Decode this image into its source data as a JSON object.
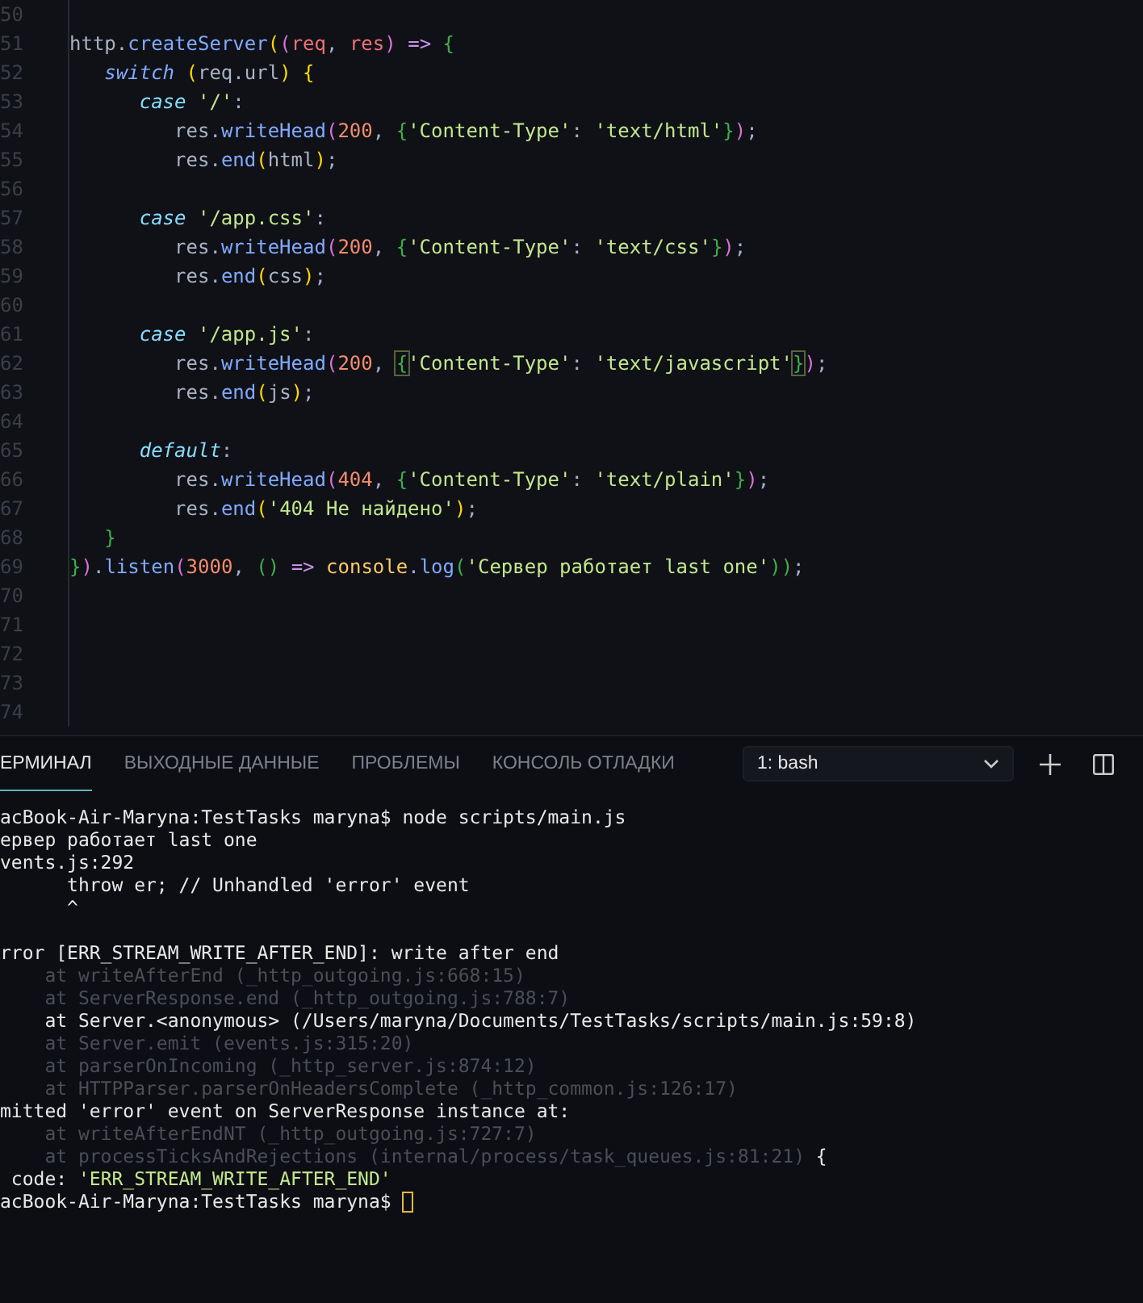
{
  "editor": {
    "lines": [
      {
        "number": "50"
      },
      {
        "number": "51",
        "tokens": [
          {
            "kind": "p",
            "text": "http"
          },
          {
            "kind": "o",
            "text": "."
          },
          {
            "kind": "f",
            "text": "createServer"
          },
          {
            "kind": "b1",
            "text": "("
          },
          {
            "kind": "b2",
            "text": "("
          },
          {
            "kind": "v",
            "text": "req"
          },
          {
            "kind": "o",
            "text": ", "
          },
          {
            "kind": "v",
            "text": "res"
          },
          {
            "kind": "b2",
            "text": ")"
          },
          {
            "kind": "op",
            "text": " => "
          },
          {
            "kind": "b3",
            "text": "{"
          }
        ]
      },
      {
        "number": "52",
        "tokens": [
          {
            "kind": "kw",
            "text": "   switch"
          },
          {
            "kind": "b1",
            "text": " ("
          },
          {
            "kind": "p",
            "text": "req"
          },
          {
            "kind": "o",
            "text": "."
          },
          {
            "kind": "p",
            "text": "url"
          },
          {
            "kind": "b1",
            "text": ")"
          },
          {
            "kind": "b1",
            "text": " {"
          }
        ]
      },
      {
        "number": "53",
        "tokens": [
          {
            "kind": "case",
            "text": "      case"
          },
          {
            "kind": "s",
            "text": " '/'"
          },
          {
            "kind": "o",
            "text": ":"
          }
        ]
      },
      {
        "number": "54",
        "tokens": [
          {
            "kind": "p",
            "text": "         res"
          },
          {
            "kind": "o",
            "text": "."
          },
          {
            "kind": "f",
            "text": "writeHead"
          },
          {
            "kind": "b2",
            "text": "("
          },
          {
            "kind": "n",
            "text": "200"
          },
          {
            "kind": "o",
            "text": ", "
          },
          {
            "kind": "b3",
            "text": "{"
          },
          {
            "kind": "s",
            "text": "'Content-Type'"
          },
          {
            "kind": "o",
            "text": ": "
          },
          {
            "kind": "s",
            "text": "'text/html'"
          },
          {
            "kind": "b3",
            "text": "}"
          },
          {
            "kind": "b2",
            "text": ")"
          },
          {
            "kind": "o",
            "text": ";"
          }
        ]
      },
      {
        "number": "55",
        "tokens": [
          {
            "kind": "p",
            "text": "         res"
          },
          {
            "kind": "o",
            "text": "."
          },
          {
            "kind": "f",
            "text": "end"
          },
          {
            "kind": "b1",
            "text": "("
          },
          {
            "kind": "p",
            "text": "html"
          },
          {
            "kind": "b1",
            "text": ")"
          },
          {
            "kind": "o",
            "text": ";"
          }
        ]
      },
      {
        "number": "56"
      },
      {
        "number": "57",
        "tokens": [
          {
            "kind": "case",
            "text": "      case"
          },
          {
            "kind": "s",
            "text": " '/app.css'"
          },
          {
            "kind": "o",
            "text": ":"
          }
        ]
      },
      {
        "number": "58",
        "tokens": [
          {
            "kind": "p",
            "text": "         res"
          },
          {
            "kind": "o",
            "text": "."
          },
          {
            "kind": "f",
            "text": "writeHead"
          },
          {
            "kind": "b2",
            "text": "("
          },
          {
            "kind": "n",
            "text": "200"
          },
          {
            "kind": "o",
            "text": ", "
          },
          {
            "kind": "b3",
            "text": "{"
          },
          {
            "kind": "s",
            "text": "'Content-Type'"
          },
          {
            "kind": "o",
            "text": ": "
          },
          {
            "kind": "s",
            "text": "'text/css'"
          },
          {
            "kind": "b3",
            "text": "}"
          },
          {
            "kind": "b2",
            "text": ")"
          },
          {
            "kind": "o",
            "text": ";"
          }
        ]
      },
      {
        "number": "59",
        "tokens": [
          {
            "kind": "p",
            "text": "         res"
          },
          {
            "kind": "o",
            "text": "."
          },
          {
            "kind": "f",
            "text": "end"
          },
          {
            "kind": "b1",
            "text": "("
          },
          {
            "kind": "p",
            "text": "css"
          },
          {
            "kind": "b1",
            "text": ")"
          },
          {
            "kind": "o",
            "text": ";"
          }
        ]
      },
      {
        "number": "60"
      },
      {
        "number": "61",
        "tokens": [
          {
            "kind": "case",
            "text": "      case"
          },
          {
            "kind": "s",
            "text": " '/app.js'"
          },
          {
            "kind": "o",
            "text": ":"
          }
        ]
      },
      {
        "number": "62",
        "tokens": [
          {
            "kind": "p",
            "text": "         res"
          },
          {
            "kind": "o",
            "text": "."
          },
          {
            "kind": "f",
            "text": "writeHead"
          },
          {
            "kind": "b2",
            "text": "("
          },
          {
            "kind": "n",
            "text": "200"
          },
          {
            "kind": "o",
            "text": ", "
          },
          {
            "kind": "match",
            "text": "{"
          },
          {
            "kind": "s",
            "text": "'Content-Type'"
          },
          {
            "kind": "o",
            "text": ": "
          },
          {
            "kind": "s",
            "text": "'text/javascript'"
          },
          {
            "kind": "match",
            "text": "}"
          },
          {
            "kind": "b2",
            "text": ")"
          },
          {
            "kind": "o",
            "text": ";"
          }
        ]
      },
      {
        "number": "63",
        "tokens": [
          {
            "kind": "p",
            "text": "         res"
          },
          {
            "kind": "o",
            "text": "."
          },
          {
            "kind": "f",
            "text": "end"
          },
          {
            "kind": "b1",
            "text": "("
          },
          {
            "kind": "p",
            "text": "js"
          },
          {
            "kind": "b1",
            "text": ")"
          },
          {
            "kind": "o",
            "text": ";"
          }
        ]
      },
      {
        "number": "64"
      },
      {
        "number": "65",
        "tokens": [
          {
            "kind": "case",
            "text": "      default"
          },
          {
            "kind": "o",
            "text": ":"
          }
        ]
      },
      {
        "number": "66",
        "tokens": [
          {
            "kind": "p",
            "text": "         res"
          },
          {
            "kind": "o",
            "text": "."
          },
          {
            "kind": "f",
            "text": "writeHead"
          },
          {
            "kind": "b2",
            "text": "("
          },
          {
            "kind": "n",
            "text": "404"
          },
          {
            "kind": "o",
            "text": ", "
          },
          {
            "kind": "b3",
            "text": "{"
          },
          {
            "kind": "s",
            "text": "'Content-Type'"
          },
          {
            "kind": "o",
            "text": ": "
          },
          {
            "kind": "s",
            "text": "'text/plain'"
          },
          {
            "kind": "b3",
            "text": "}"
          },
          {
            "kind": "b2",
            "text": ")"
          },
          {
            "kind": "o",
            "text": ";"
          }
        ]
      },
      {
        "number": "67",
        "tokens": [
          {
            "kind": "p",
            "text": "         res"
          },
          {
            "kind": "o",
            "text": "."
          },
          {
            "kind": "f",
            "text": "end"
          },
          {
            "kind": "b1",
            "text": "("
          },
          {
            "kind": "s",
            "text": "'404 Не найдено'"
          },
          {
            "kind": "b1",
            "text": ")"
          },
          {
            "kind": "o",
            "text": ";"
          }
        ]
      },
      {
        "number": "68",
        "tokens": [
          {
            "kind": "b3",
            "text": "   }"
          }
        ]
      },
      {
        "number": "69",
        "tokens": [
          {
            "kind": "b3",
            "text": "}"
          },
          {
            "kind": "b2",
            "text": ")"
          },
          {
            "kind": "o",
            "text": "."
          },
          {
            "kind": "f",
            "text": "listen"
          },
          {
            "kind": "b2",
            "text": "("
          },
          {
            "kind": "n",
            "text": "3000"
          },
          {
            "kind": "o",
            "text": ", "
          },
          {
            "kind": "b3",
            "text": "()"
          },
          {
            "kind": "op",
            "text": " => "
          },
          {
            "kind": "y",
            "text": "console"
          },
          {
            "kind": "o",
            "text": "."
          },
          {
            "kind": "f",
            "text": "log"
          },
          {
            "kind": "b3",
            "text": "("
          },
          {
            "kind": "s",
            "text": "'Сервер работает last one'"
          },
          {
            "kind": "b3",
            "text": "))"
          },
          {
            "kind": "o",
            "text": ";"
          }
        ]
      },
      {
        "number": "70"
      },
      {
        "number": "71"
      },
      {
        "number": "72"
      },
      {
        "number": "73"
      },
      {
        "number": "74"
      }
    ]
  },
  "panel": {
    "tabs": [
      {
        "label": "ЕРМИНАЛ",
        "selected": true
      },
      {
        "label": "ВЫХОДНЫЕ ДАННЫЕ",
        "selected": false
      },
      {
        "label": "ПРОБЛЕМЫ",
        "selected": false
      },
      {
        "label": "КОНСОЛЬ ОТЛАДКИ",
        "selected": false
      }
    ],
    "shell_select": "1: bash",
    "terminal": [
      {
        "kind": "normal",
        "parts": [
          {
            "kind": "t",
            "text": "acBook-Air-Maryna:TestTasks maryna$ node scripts/main.js"
          }
        ]
      },
      {
        "kind": "normal",
        "parts": [
          {
            "kind": "t",
            "text": "ервер работает last one"
          }
        ]
      },
      {
        "kind": "normal",
        "parts": [
          {
            "kind": "t",
            "text": "vents.js:292"
          }
        ]
      },
      {
        "kind": "normal",
        "parts": [
          {
            "kind": "t",
            "text": "      throw er; // Unhandled 'error' event"
          }
        ]
      },
      {
        "kind": "normal",
        "parts": [
          {
            "kind": "t",
            "text": "      ^"
          }
        ]
      },
      {
        "kind": "heading",
        "parts": [
          {
            "kind": "t",
            "text": "rror [ERR_STREAM_WRITE_AFTER_END]: write after end"
          }
        ]
      },
      {
        "kind": "dim",
        "parts": [
          {
            "kind": "t",
            "text": "    at writeAfterEnd (_http_outgoing.js:668:15)"
          }
        ]
      },
      {
        "kind": "dim",
        "parts": [
          {
            "kind": "t",
            "text": "    at ServerResponse.end (_http_outgoing.js:788:7)"
          }
        ]
      },
      {
        "kind": "normal",
        "parts": [
          {
            "kind": "t",
            "text": "    at Server.<anonymous> (/Users/maryna/Documents/TestTasks/scripts/main.js:59:8)"
          }
        ]
      },
      {
        "kind": "dim",
        "parts": [
          {
            "kind": "t",
            "text": "    at Server.emit (events.js:315:20)"
          }
        ]
      },
      {
        "kind": "dim",
        "parts": [
          {
            "kind": "t",
            "text": "    at parserOnIncoming (_http_server.js:874:12)"
          }
        ]
      },
      {
        "kind": "dim",
        "parts": [
          {
            "kind": "t",
            "text": "    at HTTPParser.parserOnHeadersComplete (_http_common.js:126:17)"
          }
        ]
      },
      {
        "kind": "normal",
        "parts": [
          {
            "kind": "t",
            "text": "mitted 'error' event on ServerResponse instance at:"
          }
        ]
      },
      {
        "kind": "dim",
        "parts": [
          {
            "kind": "t",
            "text": "    at writeAfterEndNT (_http_outgoing.js:727:7)"
          }
        ]
      },
      {
        "kind": "normal",
        "parts": [
          {
            "kind": "d",
            "text": "    at processTicksAndRejections (internal/process/task_queues.js:81:21)"
          },
          {
            "kind": "t",
            "text": " {"
          }
        ]
      },
      {
        "kind": "normal",
        "parts": [
          {
            "kind": "t",
            "text": " code: "
          },
          {
            "kind": "s",
            "text": "'ERR_STREAM_WRITE_AFTER_END'"
          }
        ]
      },
      {
        "kind": "prompt",
        "parts": [
          {
            "kind": "t",
            "text": "acBook-Air-Maryna:TestTasks maryna$"
          }
        ]
      }
    ]
  }
}
